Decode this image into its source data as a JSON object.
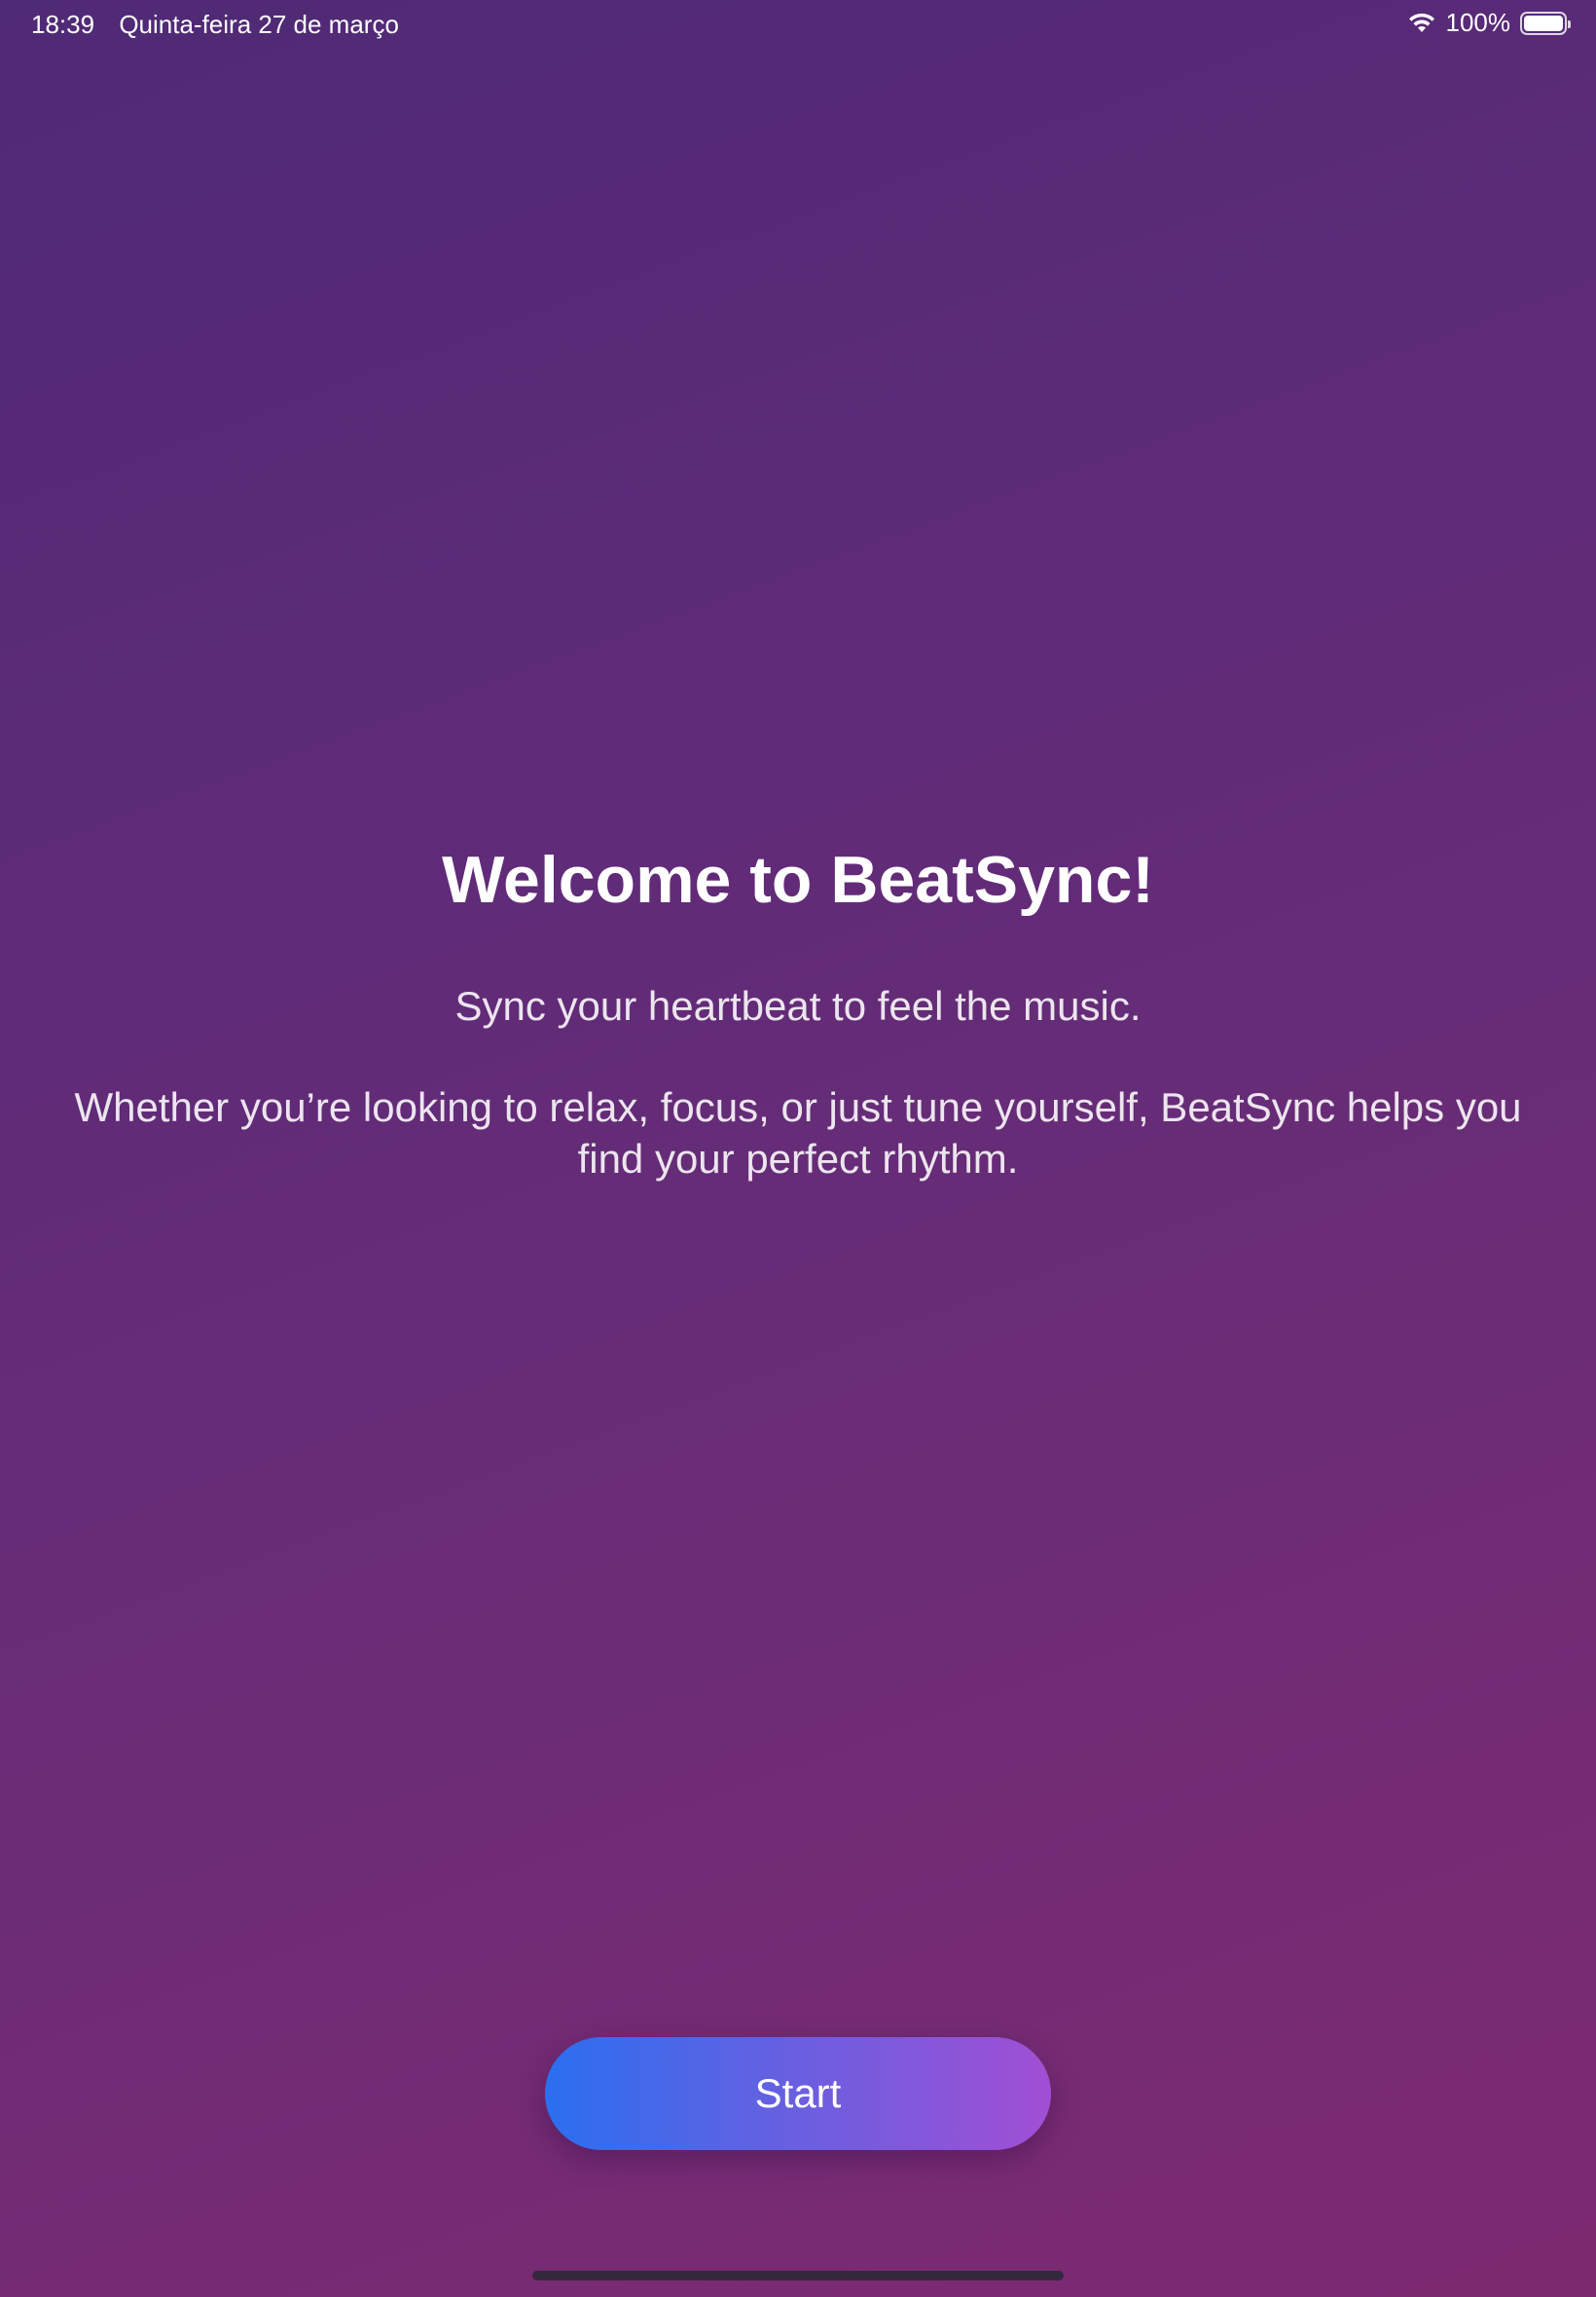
{
  "status_bar": {
    "time": "18:39",
    "date": "Quinta-feira 27 de março",
    "battery_percent": "100%",
    "icons": [
      "wifi-icon",
      "battery-icon"
    ]
  },
  "main": {
    "title": "Welcome to BeatSync!",
    "subtitle": "Sync your heartbeat to feel the music.",
    "description": "Whether you’re looking to relax, focus, or just tune yourself, BeatSync helps you find your perfect rhythm."
  },
  "actions": {
    "start_label": "Start"
  },
  "colors": {
    "background_top": "#4f2a76",
    "background_bottom": "#7e2a71",
    "button_gradient_start": "#2a6ff0",
    "button_gradient_end": "#a14fd4",
    "text": "#ffffff"
  }
}
